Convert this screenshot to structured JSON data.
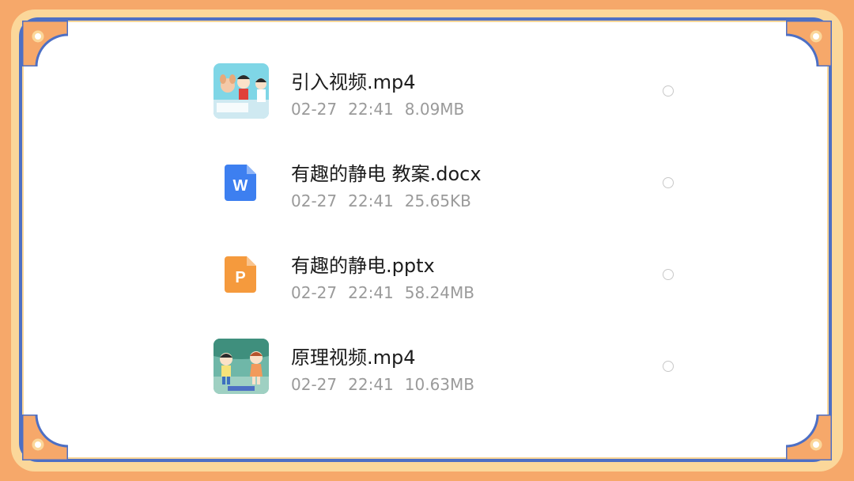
{
  "files": [
    {
      "name": "引入视频.mp4",
      "date": "02-27",
      "time": "22:41",
      "size": "8.09MB",
      "icon": "video-thumbnail-icon"
    },
    {
      "name": "有趣的静电 教案.docx",
      "date": "02-27",
      "time": "22:41",
      "size": "25.65KB",
      "icon": "word-document-icon",
      "icon_letter": "W",
      "icon_color": "#3d7ff0"
    },
    {
      "name": "有趣的静电.pptx",
      "date": "02-27",
      "time": "22:41",
      "size": "58.24MB",
      "icon": "powerpoint-document-icon",
      "icon_letter": "P",
      "icon_color": "#f59a3d"
    },
    {
      "name": "原理视频.mp4",
      "date": "02-27",
      "time": "22:41",
      "size": "10.63MB",
      "icon": "video-thumbnail-icon"
    }
  ],
  "colors": {
    "background": "#f6a86a",
    "frame_blue": "#4d6fc4",
    "frame_cream": "#fbd79a"
  }
}
